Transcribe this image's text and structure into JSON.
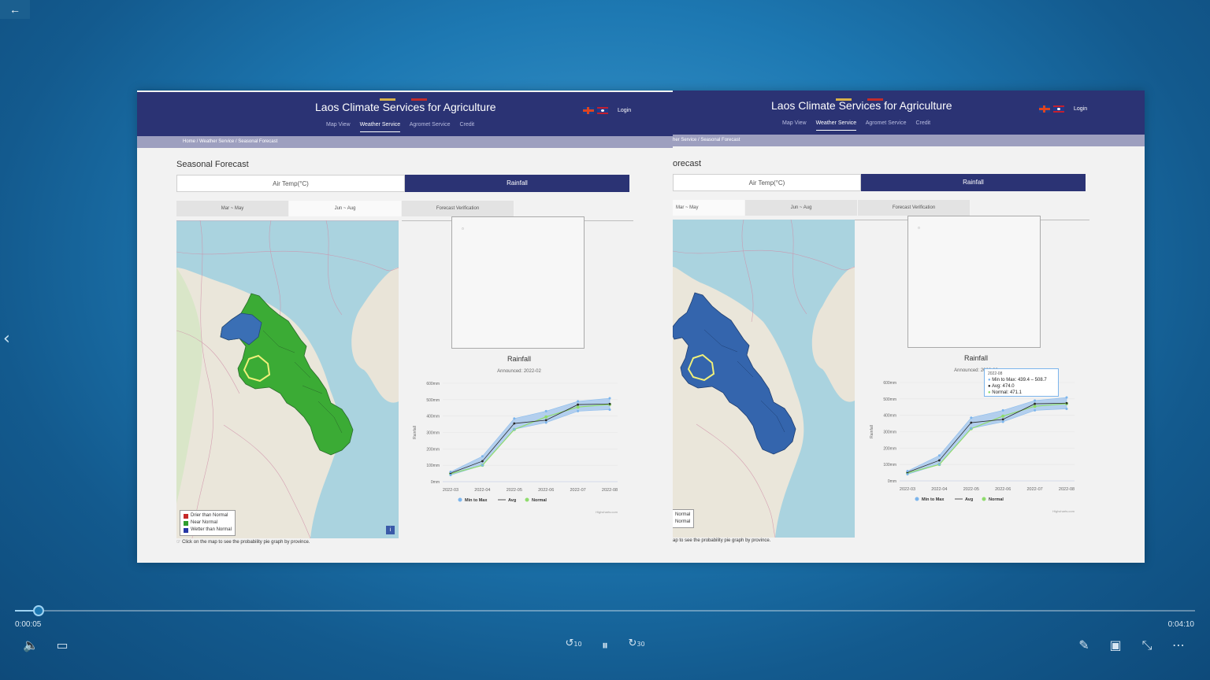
{
  "player": {
    "current_time": "0:00:05",
    "total_time": "0:04:10",
    "progress_fraction": 0.02,
    "skip_back_label": "10",
    "skip_forward_label": "30"
  },
  "site": {
    "title": "Laos Climate Services for Agriculture",
    "nav": [
      "Map View",
      "Weather Service",
      "Agromet Service",
      "Credit"
    ],
    "active_nav": "Weather Service",
    "login": "Login"
  },
  "left": {
    "breadcrumb": "Home   /   Weather Service   /   Seasonal Forecast",
    "section_title": "Seasonal Forecast",
    "type_tabs": [
      "Air Temp(°C)",
      "Rainfall"
    ],
    "season_tabs": [
      "Mar ~ May",
      "Jun ~ Aug",
      "Forecast Verification"
    ],
    "legend": [
      "Drier than Normal",
      "Near Normal",
      "Wetter than Normal"
    ],
    "hint": "Click on the map to see the probability pie graph by province.",
    "info": "i"
  },
  "right": {
    "breadcrumb": "her Service   /   Seasonal Forecast",
    "section_title": "orecast",
    "type_tabs": [
      "Air Temp(°C)",
      "Rainfall"
    ],
    "season_tabs": [
      "Mar ~ May",
      "Jun ~ Aug",
      "Forecast Verification"
    ],
    "legend": [
      "Normal",
      "Normal"
    ],
    "hint": "ap to see the probability pie graph by province.",
    "tooltip": {
      "date": "2022-08",
      "min_max": "Min to Max:  439.4 – 508.7",
      "avg": "Avg:  474.0",
      "normal": "Normal:  471.1"
    }
  },
  "chart_data": {
    "type": "line",
    "title": "Rainfall",
    "subtitle": "Announced:  2022-02",
    "ylabel": "Rainfall",
    "ylim": [
      0,
      600
    ],
    "yticks": [
      "0mm",
      "100mm",
      "200mm",
      "300mm",
      "400mm",
      "500mm",
      "600mm"
    ],
    "x": [
      "2022-03",
      "2022-04",
      "2022-05",
      "2022-06",
      "2022-07",
      "2022-08"
    ],
    "series": [
      {
        "name": "Min to Max",
        "type": "arearange",
        "low": [
          40,
          100,
          320,
          360,
          430,
          439.4
        ],
        "high": [
          60,
          155,
          385,
          430,
          490,
          508.7
        ]
      },
      {
        "name": "Avg",
        "values": [
          52,
          125,
          355,
          375,
          470,
          474.0
        ]
      },
      {
        "name": "Normal",
        "values": [
          48,
          100,
          318,
          395,
          455,
          471.1
        ]
      }
    ],
    "credit": "Highcharts.com",
    "colors": {
      "range": "#a9c9ee",
      "avg": "#2b2b2b",
      "normal": "#8fdc6d",
      "marker": "#7cb5ec"
    }
  },
  "legend_colors": {
    "drier": "#c62828",
    "near": "#2e9e2e",
    "wetter": "#2638a6"
  },
  "map_colors": {
    "left_fill": "#3bab35",
    "left_fill_nw": "#3a6fb5",
    "right_fill": "#3465ad",
    "highlight": "#f0f07a"
  }
}
